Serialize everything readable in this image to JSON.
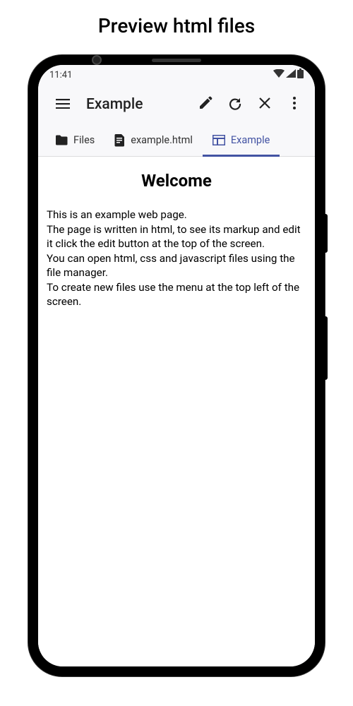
{
  "page": {
    "title": "Preview html files"
  },
  "status_bar": {
    "time": "11:41"
  },
  "app_bar": {
    "title": "Example"
  },
  "tabs": {
    "items": [
      {
        "label": "Files"
      },
      {
        "label": "example.html"
      },
      {
        "label": "Example"
      }
    ]
  },
  "content": {
    "heading": "Welcome",
    "body": "This is an example web page.\nThe page is written in html, to see its markup and edit it click the edit button at the top of the screen.\nYou can open html, css and javascript files using the file manager.\nTo create new files use the menu at the top left of the screen."
  }
}
